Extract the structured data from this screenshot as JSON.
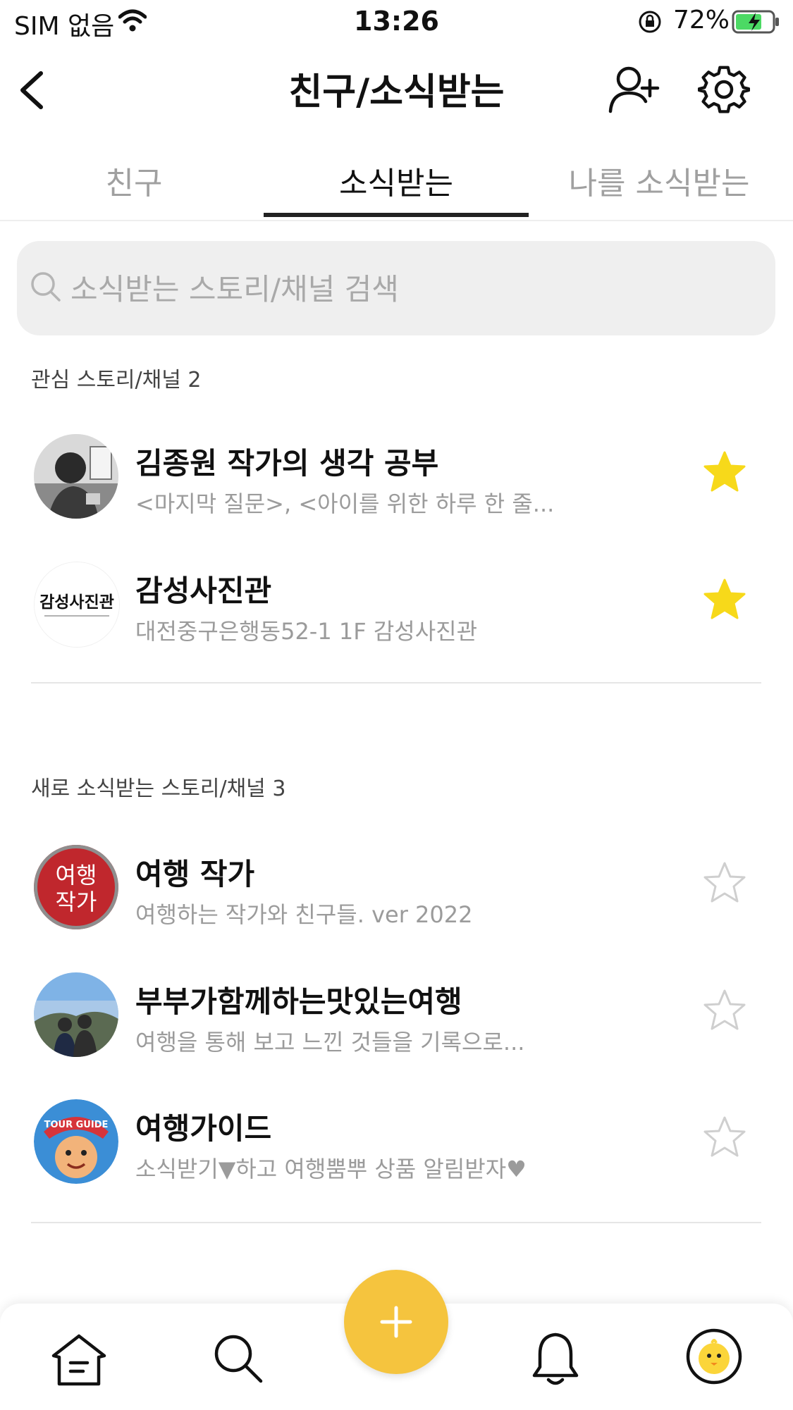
{
  "status_bar": {
    "carrier": "SIM 없음",
    "time": "13:26",
    "battery_percent": "72%",
    "battery_level": 0.72
  },
  "nav": {
    "title": "친구/소식받는",
    "back_icon": "chevron-left-icon",
    "add_icon": "add-friend-icon",
    "settings_icon": "gear-icon"
  },
  "tabs": [
    {
      "label": "친구",
      "selected": false
    },
    {
      "label": "소식받는",
      "selected": true
    },
    {
      "label": "나를 소식받는",
      "selected": false
    }
  ],
  "search": {
    "placeholder": "소식받는 스토리/채널 검색",
    "value": ""
  },
  "favorites": {
    "header": "관심 스토리/채널 2",
    "items": [
      {
        "title": "김종원 작가의 생각 공부",
        "subtitle": "<마지막 질문>, <아이를 위한 하루 한 줄...",
        "starred": true
      },
      {
        "title": "감성사진관",
        "subtitle": "대전중구은행동52-1 1F 감성사진관",
        "starred": true,
        "avatar_text": "감성사진관"
      }
    ]
  },
  "new_channels": {
    "header": "새로 소식받는 스토리/채널 3",
    "items": [
      {
        "title": "여행 작가",
        "subtitle": "여행하는 작가와 친구들. ver 2022",
        "starred": false,
        "avatar_text_line1": "여행",
        "avatar_text_line2": "작가"
      },
      {
        "title": "부부가함께하는맛있는여행",
        "subtitle": "여행을 통해 보고 느낀 것들을 기록으로...",
        "starred": false
      },
      {
        "title": "여행가이드",
        "subtitle": "소식받기▼하고 여행뿜뿌 상품 알림받자♥",
        "starred": false,
        "avatar_text": "TOUR GUIDE"
      }
    ]
  },
  "tab_bar": {
    "items": [
      "home-icon",
      "search-icon",
      "add-icon",
      "bell-icon",
      "profile-icon"
    ]
  },
  "colors": {
    "accent_yellow": "#f5c43e",
    "star_filled": "#f7d91a",
    "star_empty": "#cfcfcf"
  }
}
